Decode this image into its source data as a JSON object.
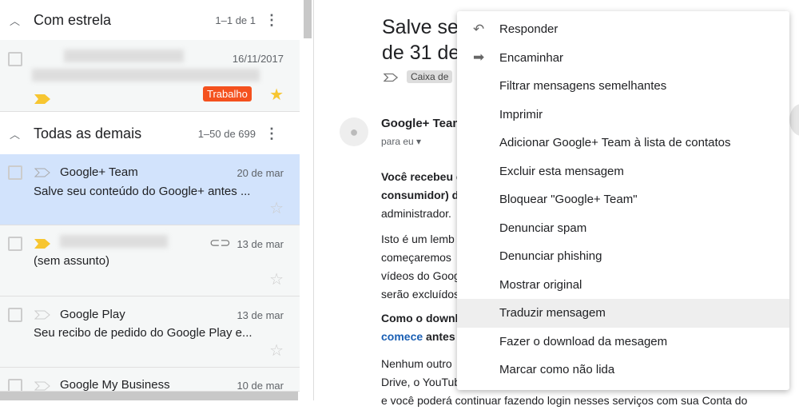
{
  "starred": {
    "title": "Com estrela",
    "count": "1–1 de 1",
    "items": [
      {
        "date": "16/11/2017",
        "label": "Trabalho"
      }
    ]
  },
  "others": {
    "title": "Todas as demais",
    "count": "1–50 de 699",
    "items": [
      {
        "sender": "Google+ Team",
        "date": "20 de mar",
        "subject": "Salve seu conteúdo do Google+ antes ..."
      },
      {
        "sender": "",
        "date": "13 de mar",
        "subject": "(sem assunto)"
      },
      {
        "sender": "Google Play",
        "date": "13 de mar",
        "subject": "Seu recibo de pedido do Google Play e..."
      },
      {
        "sender": "Google My Business",
        "date": "10 de mar"
      }
    ]
  },
  "email": {
    "title1": "Salve seu",
    "title2": "de 31 de",
    "label": "Caixa de",
    "from": "Google+ Team",
    "to": "para eu",
    "p1a": "Você recebeu e",
    "p1b": "consumidor) d",
    "p1c": "administrador.",
    "p2a": "Isto é um lemb",
    "p2b": "começaremos",
    "p2c": "vídeos do Goog",
    "p2d": "serão excluídos",
    "p3a": "Como o downl",
    "p3link": "comece",
    "p3b": " antes",
    "p4a": "Nenhum outro",
    "p4b": "Drive, o YouTub",
    "p4c": "e você poderá continuar fazendo login nesses serviços com sua Conta do"
  },
  "menu": [
    "Responder",
    "Encaminhar",
    "Filtrar mensagens semelhantes",
    "Imprimir",
    "Adicionar Google+ Team à lista de contatos",
    "Excluir esta mensagem",
    "Bloquear \"Google+ Team\"",
    "Denunciar spam",
    "Denunciar phishing",
    "Mostrar original",
    "Traduzir mensagem",
    "Fazer o download da mesagem",
    "Marcar como não lida"
  ],
  "colors": {
    "selected": "#d2e3fc",
    "label": "#f4511e",
    "important": "#f7c631",
    "star": "#f7c631"
  }
}
